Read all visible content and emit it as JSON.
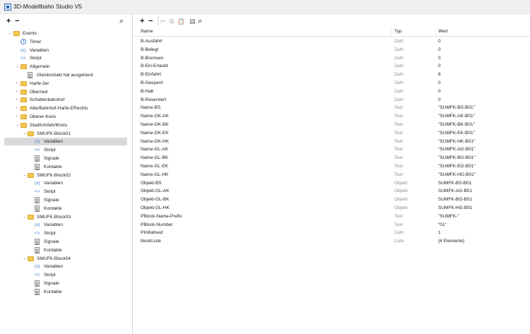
{
  "window": {
    "title": "3D-Modellbahn Studio V5"
  },
  "left_toolbar": {
    "add": "+",
    "remove": "−",
    "search": "⌕"
  },
  "right_toolbar": {
    "add": "+",
    "remove": "−",
    "separator": "│",
    "cut": "✂",
    "copy": "⧉",
    "paste": "📋",
    "script": "▤",
    "search": "⌕"
  },
  "tree": [
    {
      "label": "Events",
      "icon": "folder-icon",
      "chev": "open",
      "indent": 0
    },
    {
      "label": "Timer",
      "icon": "timer-icon",
      "chev": "none",
      "indent": 1
    },
    {
      "label": "Variablen",
      "icon": "variables-icon",
      "chev": "none",
      "indent": 1
    },
    {
      "label": "Skript",
      "icon": "code-icon",
      "chev": "none",
      "indent": 1
    },
    {
      "label": "Allgemein",
      "icon": "folder-icon",
      "chev": "open",
      "indent": 1
    },
    {
      "label": "Gleiskontakt hat ausgeloest",
      "icon": "document-icon",
      "chev": "none",
      "indent": 2
    },
    {
      "label": "Harfe-3er",
      "icon": "folder-icon",
      "chev": "closed",
      "indent": 1
    },
    {
      "label": "Oberried",
      "icon": "folder-icon",
      "chev": "closed",
      "indent": 1
    },
    {
      "label": "Schattenbahnhof",
      "icon": "folder-icon",
      "chev": "closed",
      "indent": 1
    },
    {
      "label": "AlterBahnhof-Harfe-ERechts",
      "icon": "folder-icon",
      "chev": "closed",
      "indent": 1
    },
    {
      "label": "Oberer-Kreis",
      "icon": "folder-icon",
      "chev": "closed",
      "indent": 1
    },
    {
      "label": "StadtUmfahrtKreis",
      "icon": "folder-icon",
      "chev": "open",
      "indent": 1
    },
    {
      "label": "SMUFK-Block01",
      "icon": "folder-icon",
      "chev": "open",
      "indent": 2
    },
    {
      "label": "Variablen",
      "icon": "variables-icon",
      "chev": "none",
      "indent": 3,
      "selected": true
    },
    {
      "label": "Skript",
      "icon": "code-icon",
      "chev": "none",
      "indent": 3
    },
    {
      "label": "Signale",
      "icon": "document-icon",
      "chev": "none",
      "indent": 3
    },
    {
      "label": "Kontakte",
      "icon": "document-icon",
      "chev": "none",
      "indent": 3
    },
    {
      "label": "SMUFK-Block02",
      "icon": "folder-icon",
      "chev": "open",
      "indent": 2
    },
    {
      "label": "Variablen",
      "icon": "variables-icon",
      "chev": "none",
      "indent": 3
    },
    {
      "label": "Skript",
      "icon": "code-icon",
      "chev": "none",
      "indent": 3
    },
    {
      "label": "Signale",
      "icon": "document-icon",
      "chev": "none",
      "indent": 3
    },
    {
      "label": "Kontakte",
      "icon": "document-icon",
      "chev": "none",
      "indent": 3
    },
    {
      "label": "SMUFK-Block03",
      "icon": "folder-icon",
      "chev": "open",
      "indent": 2
    },
    {
      "label": "Variablen",
      "icon": "variables-icon",
      "chev": "none",
      "indent": 3
    },
    {
      "label": "Skript",
      "icon": "code-icon",
      "chev": "none",
      "indent": 3
    },
    {
      "label": "Signale",
      "icon": "document-icon",
      "chev": "none",
      "indent": 3
    },
    {
      "label": "Kontakte",
      "icon": "document-icon",
      "chev": "none",
      "indent": 3
    },
    {
      "label": "SMUFK-Block04",
      "icon": "folder-icon",
      "chev": "open",
      "indent": 2
    },
    {
      "label": "Variablen",
      "icon": "variables-icon",
      "chev": "none",
      "indent": 3
    },
    {
      "label": "Skript",
      "icon": "code-icon",
      "chev": "none",
      "indent": 3
    },
    {
      "label": "Signale",
      "icon": "document-icon",
      "chev": "none",
      "indent": 3
    },
    {
      "label": "Kontakte",
      "icon": "document-icon",
      "chev": "none",
      "indent": 3
    }
  ],
  "grid": {
    "headers": {
      "name": "Name",
      "type": "Typ",
      "value": "Wert"
    },
    "rows": [
      {
        "name": "B-Ausfahrt",
        "type": "Zahl",
        "value": "0"
      },
      {
        "name": "B-Belegt",
        "type": "Zahl",
        "value": "0"
      },
      {
        "name": "B-Bremsen",
        "type": "Zahl",
        "value": "0"
      },
      {
        "name": "B-Ein-Erlaubt",
        "type": "Zahl",
        "value": "0"
      },
      {
        "name": "B-Einfahrt",
        "type": "Zahl",
        "value": "8"
      },
      {
        "name": "B-Gesperrt",
        "type": "Zahl",
        "value": "0"
      },
      {
        "name": "B-Halt",
        "type": "Zahl",
        "value": "0"
      },
      {
        "name": "B-Reserviert",
        "type": "Zahl",
        "value": "0"
      },
      {
        "name": "Name-BS",
        "type": "Text",
        "value": "\"SUMFK-BS-B01\""
      },
      {
        "name": "Name-GK-AK",
        "type": "Text",
        "value": "\"SUMFK-AK-B01\""
      },
      {
        "name": "Name-GK-BK",
        "type": "Text",
        "value": "\"SUMFK-BK-B01\""
      },
      {
        "name": "Name-GK-EK",
        "type": "Text",
        "value": "\"SUMFK-EK-B01\""
      },
      {
        "name": "Name-GK-HK",
        "type": "Text",
        "value": "\"SUMFK-HK-B01\""
      },
      {
        "name": "Name-GL-AK",
        "type": "Text",
        "value": "\"SUMFK-AG-B01\""
      },
      {
        "name": "Name-GL-BK",
        "type": "Text",
        "value": "\"SUMFK-BG-B01\""
      },
      {
        "name": "Name-GL-EK",
        "type": "Text",
        "value": "\"SUMFK-EG-B01\""
      },
      {
        "name": "Name-GL-HK",
        "type": "Text",
        "value": "\"SUMFK-HG-B01\""
      },
      {
        "name": "Objekt-BS",
        "type": "Objekt",
        "value": "SUMFK-BS-B01"
      },
      {
        "name": "Objekt-GL-AK",
        "type": "Objekt",
        "value": "SUMFK-AG-B01"
      },
      {
        "name": "Objekt-GL-BK",
        "type": "Objekt",
        "value": "SUMFK-BG-B01"
      },
      {
        "name": "Objekt-GL-HK",
        "type": "Objekt",
        "value": "SUMFK-HG-B01"
      },
      {
        "name": "PBlock-Name-Prefix",
        "type": "Text",
        "value": "\"SUMFK-\""
      },
      {
        "name": "PBlock-Number",
        "type": "Text",
        "value": "\"01\""
      },
      {
        "name": "PInitialised",
        "type": "Zahl",
        "value": "1"
      },
      {
        "name": "blockListe",
        "type": "Liste",
        "value": "{4 Elemente}"
      }
    ]
  }
}
